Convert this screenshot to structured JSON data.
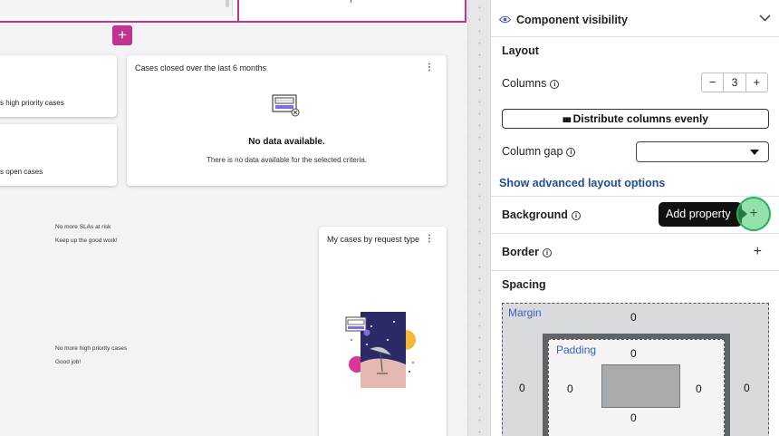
{
  "canvas": {
    "add_button_icon": "+",
    "stat_high": {
      "text": "s high priority cases"
    },
    "stat_open": {
      "text": "s open cases"
    },
    "cases_closed": {
      "title": "Cases closed over the last 6 months",
      "kebab": "⋮",
      "empty_title": "No data available.",
      "empty_subtitle": "There is no data available for the selected criteria."
    },
    "sla": {
      "title": "No more SLAs at risk",
      "subtitle": "Keep up the good work!"
    },
    "high_priority": {
      "title": "No more high priority cases",
      "subtitle": "Good job!"
    },
    "by_type": {
      "title": "My cases by request type",
      "kebab": "⋮"
    }
  },
  "panel": {
    "header_title": "Component visibility",
    "layout_label": "Layout",
    "columns_label": "Columns",
    "columns_value": "3",
    "minus": "−",
    "plus": "+",
    "distribute_label": "Distribute columns evenly",
    "column_gap_label": "Column gap",
    "advanced_link": "Show advanced layout options",
    "background_label": "Background",
    "tooltip": "Add property",
    "border_label": "Border",
    "spacing_label": "Spacing",
    "margin_label": "Margin",
    "padding_label": "Padding",
    "margin": {
      "top": "0",
      "left": "0",
      "right": "0"
    },
    "padding": {
      "top": "0",
      "left": "0",
      "right": "0",
      "bottom": "0"
    }
  },
  "colors": {
    "accent": "#c2338f",
    "link": "#1f4e96",
    "highlight": "#3dc86e"
  }
}
